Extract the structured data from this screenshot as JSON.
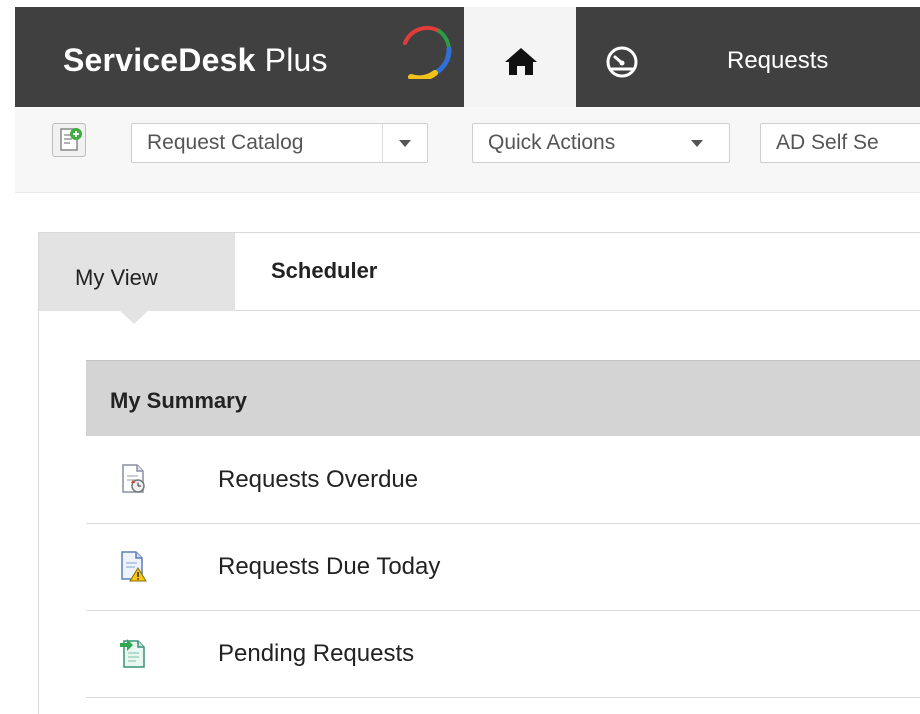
{
  "header": {
    "logo_main": "ServiceDesk",
    "logo_sub": " Plus",
    "nav": {
      "home_icon": "home-icon",
      "dashboard_icon": "dashboard-icon",
      "requests_label": "Requests"
    }
  },
  "toolbar": {
    "new_request_icon": "new-request-icon",
    "request_catalog_label": "Request Catalog",
    "quick_actions_label": "Quick Actions",
    "ad_self_service_label": "AD Self Se"
  },
  "tabs": [
    {
      "label": "My View",
      "active": true
    },
    {
      "label": "Scheduler",
      "active": false
    }
  ],
  "summary": {
    "title": "My Summary",
    "items": [
      {
        "label": "Requests Overdue",
        "icon": "request-overdue-icon"
      },
      {
        "label": "Requests Due Today",
        "icon": "request-due-today-icon"
      },
      {
        "label": "Pending Requests",
        "icon": "pending-requests-icon"
      }
    ]
  },
  "colors": {
    "header_bg": "#404040",
    "home_tab_bg": "#f4f4f4",
    "toolbar_bg": "#f7f7f7",
    "tab_active_bg": "#e3e3e3",
    "summary_header_bg": "#d4d4d4"
  }
}
